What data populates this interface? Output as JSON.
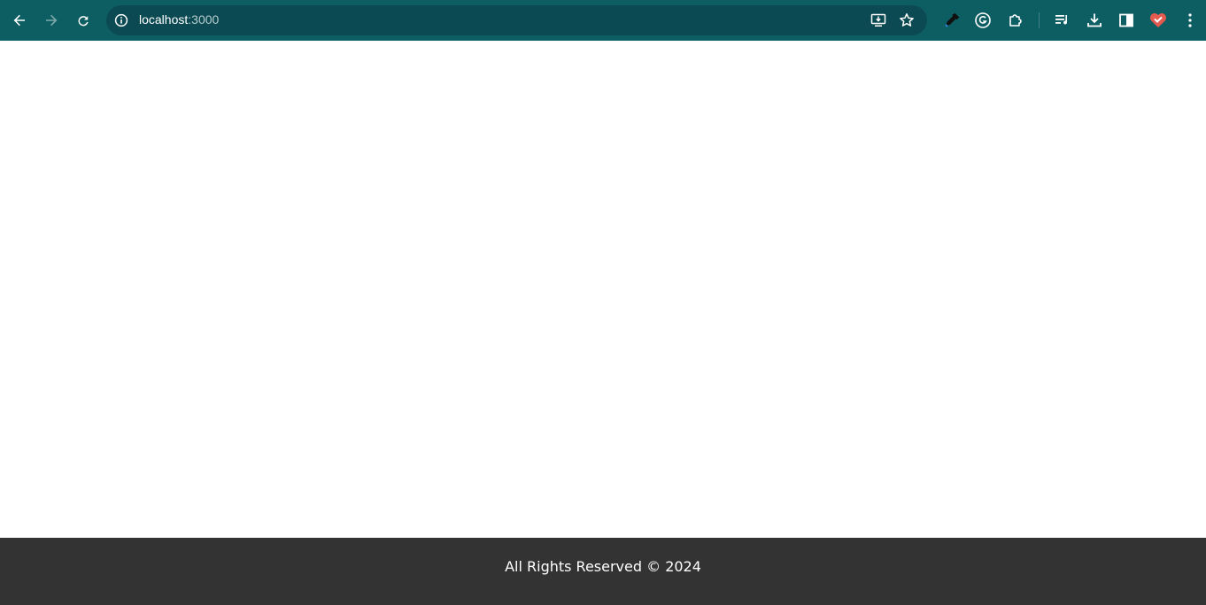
{
  "browser": {
    "url_host": "localhost",
    "url_port": ":3000",
    "icons": {
      "back": "arrow-left-icon",
      "forward": "arrow-right-icon",
      "reload": "reload-icon",
      "site_info": "info-icon",
      "install": "install-app-icon",
      "bookmark": "star-icon",
      "eyedropper": "eyedropper-extension-icon",
      "grammarly": "grammarly-extension-icon",
      "extensions": "puzzle-icon",
      "reading_list": "reading-list-icon",
      "downloads": "download-icon",
      "side_panel": "side-panel-icon",
      "heart_extension": "heart-extension-icon",
      "menu": "kebab-menu-icon"
    },
    "colors": {
      "toolbar": "#0d5e63",
      "omnibox": "#0b4a52",
      "heart": "#e35a4f"
    }
  },
  "footer": {
    "text": "All Rights Reserved © 2024",
    "background": "#333333"
  }
}
